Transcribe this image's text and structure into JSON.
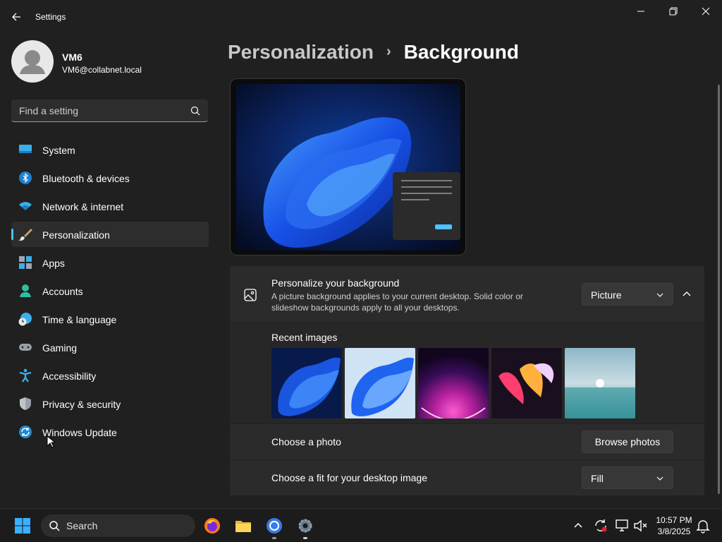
{
  "window": {
    "title": "Settings",
    "controls": {
      "minimize": "minimize-icon",
      "maximize": "restore-icon",
      "close": "close-icon"
    }
  },
  "profile": {
    "name": "VM6",
    "email": "VM6@collabnet.local"
  },
  "search": {
    "placeholder": "Find a setting"
  },
  "sidebar": {
    "items": [
      {
        "label": "System",
        "icon": "system-icon",
        "active": false
      },
      {
        "label": "Bluetooth & devices",
        "icon": "bluetooth-icon",
        "active": false
      },
      {
        "label": "Network & internet",
        "icon": "wifi-icon",
        "active": false
      },
      {
        "label": "Personalization",
        "icon": "brush-icon",
        "active": true
      },
      {
        "label": "Apps",
        "icon": "apps-icon",
        "active": false
      },
      {
        "label": "Accounts",
        "icon": "person-icon",
        "active": false
      },
      {
        "label": "Time & language",
        "icon": "globe-clock-icon",
        "active": false
      },
      {
        "label": "Gaming",
        "icon": "gamepad-icon",
        "active": false
      },
      {
        "label": "Accessibility",
        "icon": "accessibility-icon",
        "active": false
      },
      {
        "label": "Privacy & security",
        "icon": "shield-icon",
        "active": false
      },
      {
        "label": "Windows Update",
        "icon": "update-icon",
        "active": false
      }
    ]
  },
  "breadcrumb": {
    "parent": "Personalization",
    "separator": "›",
    "current": "Background"
  },
  "background": {
    "title": "Personalize your background",
    "description": "A picture background applies to your current desktop. Solid color or slideshow backgrounds apply to all your desktops.",
    "type_value": "Picture",
    "recent_label": "Recent images",
    "choose_photo_label": "Choose a photo",
    "browse_button": "Browse photos",
    "fit_label": "Choose a fit for your desktop image",
    "fit_value": "Fill"
  },
  "taskbar": {
    "search_label": "Search",
    "apps": [
      "windows-start-icon",
      "firefox-icon",
      "file-explorer-icon",
      "chrome-icon",
      "settings-icon"
    ],
    "time": "10:57 PM",
    "date": "3/8/2025"
  },
  "colors": {
    "accent": "#4cc2ff",
    "background": "#202020",
    "card": "#2b2b2b"
  }
}
